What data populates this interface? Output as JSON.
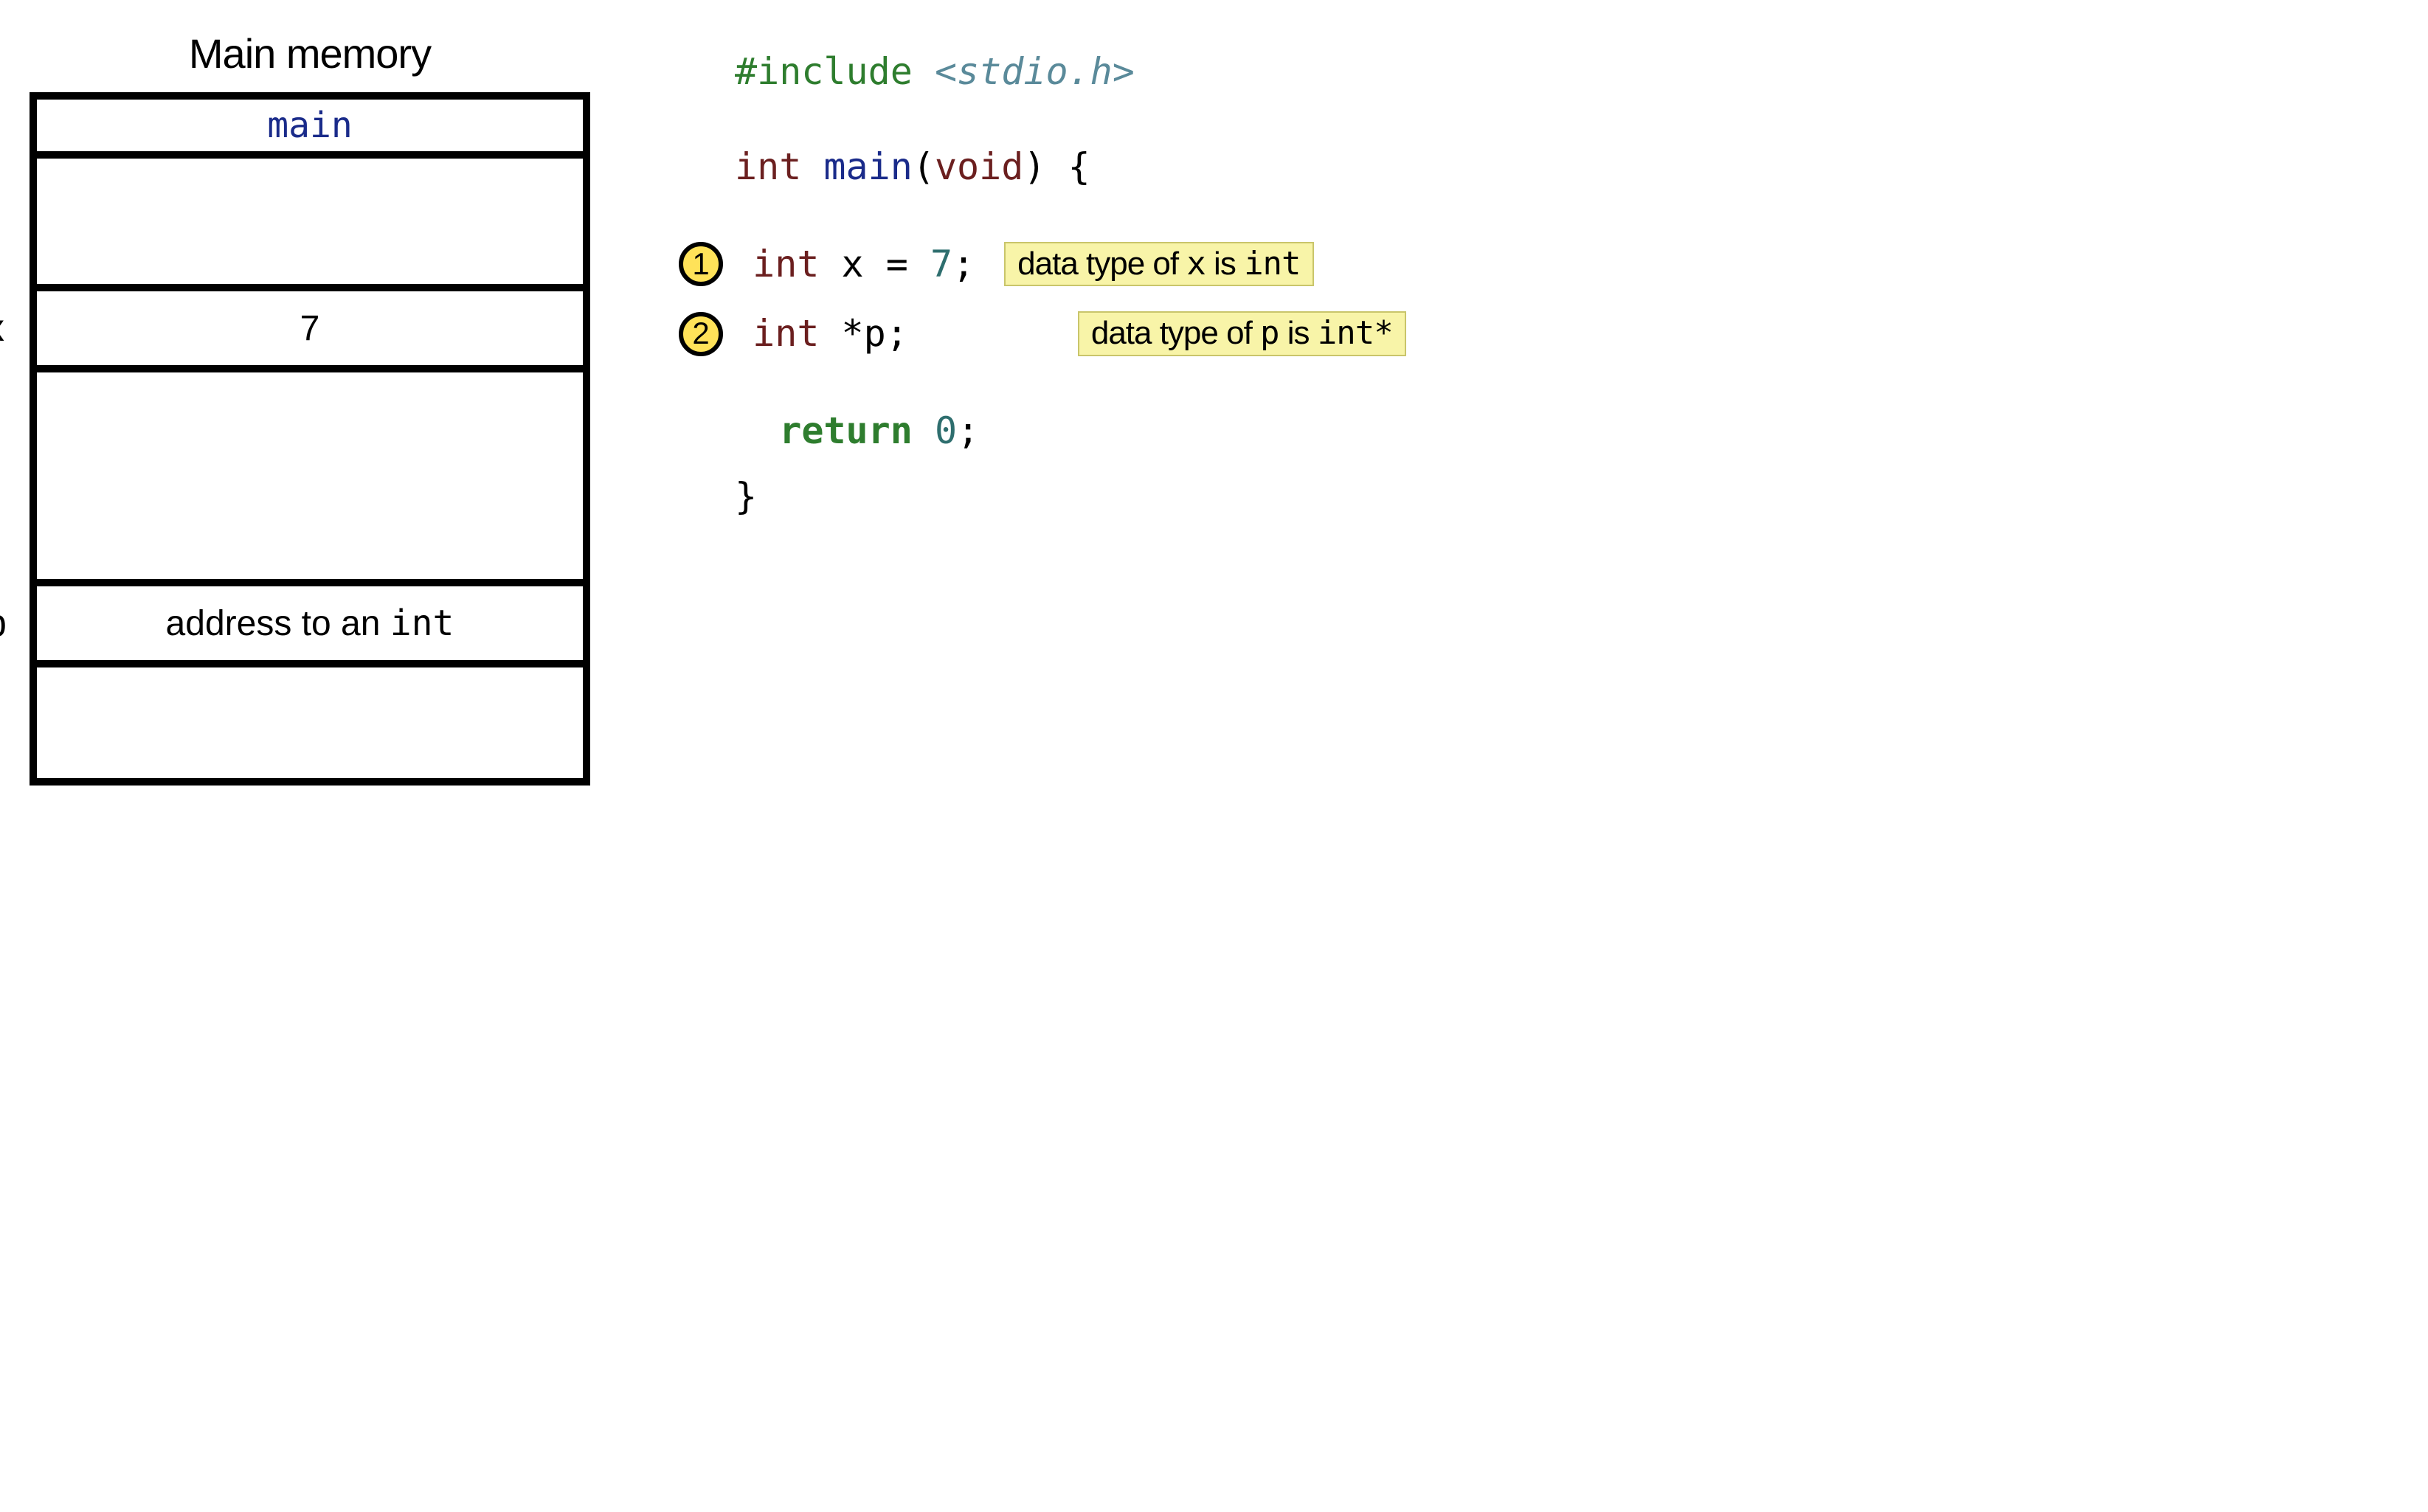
{
  "memory": {
    "title": "Main memory",
    "header": "main",
    "x_label": "x",
    "x_value": "7",
    "p_label": "p",
    "p_value_prefix": "address to an ",
    "p_value_type": "int"
  },
  "code": {
    "include_keyword": "#include",
    "include_header": "<stdio.h>",
    "sig_type": "int",
    "sig_name": "main",
    "sig_paren_open": "(",
    "sig_void": "void",
    "sig_paren_close_brace": ") {",
    "line1_num": "1",
    "line1_type": "int",
    "line1_rest": " x = ",
    "line1_val": "7",
    "line1_semi": ";",
    "note1_prefix": "data type of ",
    "note1_var": "x",
    "note1_mid": " is ",
    "note1_type": "int",
    "line2_num": "2",
    "line2_type": "int",
    "line2_rest": " *p;",
    "note2_prefix": "data type of ",
    "note2_var": "p",
    "note2_mid": " is ",
    "note2_type": "int*",
    "return_kw": "return",
    "return_val": " 0",
    "return_semi": ";",
    "close_brace": "}"
  }
}
